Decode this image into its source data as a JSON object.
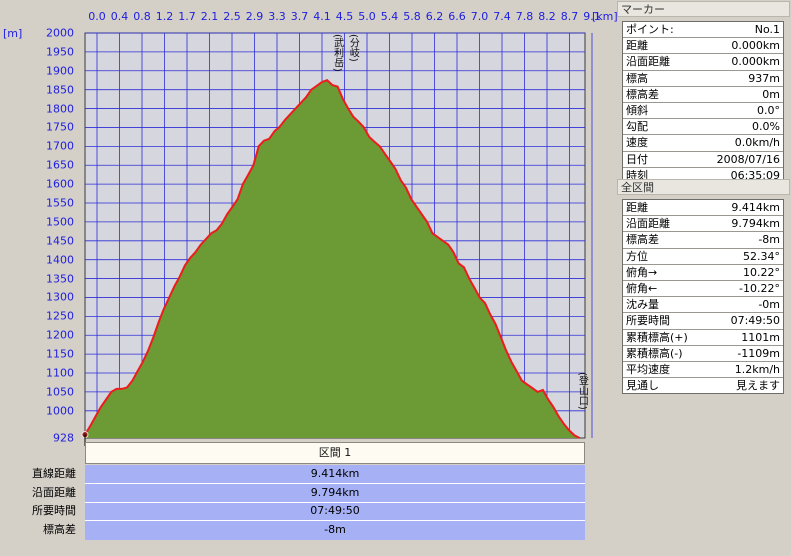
{
  "chart_data": {
    "type": "area",
    "x_unit": "[km]",
    "y_unit": "[m]",
    "x_ticks": [
      "0.0",
      "0.4",
      "0.8",
      "1.2",
      "1.7",
      "2.1",
      "2.5",
      "2.9",
      "3.3",
      "3.7",
      "4.1",
      "4.5",
      "5.0",
      "5.4",
      "5.8",
      "6.2",
      "6.6",
      "7.0",
      "7.4",
      "7.8",
      "8.2",
      "8.7",
      "9.1"
    ],
    "y_ticks": [
      2000,
      1950,
      1900,
      1850,
      1800,
      1750,
      1700,
      1650,
      1600,
      1550,
      1500,
      1450,
      1400,
      1350,
      1300,
      1250,
      1200,
      1150,
      1100,
      1050,
      1000
    ],
    "y_min_label": "928",
    "xlim": [
      0,
      9.5
    ],
    "ylim": [
      928,
      2000
    ],
    "grid": true,
    "fill_color": "#6c9a35",
    "line_color": "#ee1c1c",
    "series": [
      {
        "x": [
          0.0,
          0.1,
          0.2,
          0.3,
          0.4,
          0.5,
          0.6,
          0.7,
          0.8,
          0.9,
          1.0,
          1.1,
          1.2,
          1.3,
          1.4,
          1.5,
          1.6,
          1.7,
          1.8,
          1.9,
          2.0,
          2.1,
          2.2,
          2.3,
          2.4,
          2.5,
          2.6,
          2.7,
          2.8,
          2.9,
          3.0,
          3.1,
          3.2,
          3.3,
          3.4,
          3.5,
          3.6,
          3.7,
          3.8,
          3.9,
          4.0,
          4.1,
          4.2,
          4.3,
          4.4,
          4.5,
          4.6,
          4.7,
          4.8,
          4.9,
          5.0,
          5.1,
          5.2,
          5.3,
          5.4,
          5.5,
          5.6,
          5.7,
          5.8,
          5.9,
          6.0,
          6.1,
          6.2,
          6.3,
          6.4,
          6.5,
          6.6,
          6.7,
          6.8,
          6.9,
          7.0,
          7.1,
          7.2,
          7.3,
          7.4,
          7.5,
          7.6,
          7.7,
          7.8,
          7.9,
          8.0,
          8.1,
          8.2,
          8.3,
          8.4,
          8.5,
          8.6,
          8.7,
          8.8,
          8.9,
          9.0,
          9.1,
          9.2,
          9.3,
          9.4
        ],
        "y": [
          937,
          960,
          985,
          1010,
          1030,
          1050,
          1058,
          1058,
          1062,
          1080,
          1105,
          1130,
          1160,
          1195,
          1235,
          1270,
          1300,
          1330,
          1355,
          1385,
          1405,
          1420,
          1440,
          1455,
          1470,
          1478,
          1495,
          1520,
          1540,
          1560,
          1600,
          1625,
          1650,
          1700,
          1715,
          1720,
          1740,
          1752,
          1770,
          1785,
          1800,
          1815,
          1830,
          1850,
          1860,
          1870,
          1875,
          1862,
          1858,
          1825,
          1800,
          1778,
          1765,
          1750,
          1725,
          1712,
          1700,
          1680,
          1660,
          1640,
          1610,
          1590,
          1560,
          1540,
          1520,
          1500,
          1470,
          1460,
          1450,
          1440,
          1420,
          1390,
          1380,
          1350,
          1325,
          1300,
          1285,
          1255,
          1230,
          1195,
          1160,
          1130,
          1105,
          1080,
          1070,
          1060,
          1050,
          1055,
          1030,
          1010,
          985,
          965,
          948,
          935,
          928
        ]
      }
    ]
  },
  "annotations": [
    {
      "text": "(武利岳)",
      "x": 4.8
    },
    {
      "text": "(分岐)",
      "x": 5.1
    },
    {
      "text": "(登山口)",
      "x": 9.45
    }
  ],
  "section": {
    "title": "区間 1",
    "rows": [
      {
        "label": "直線距離",
        "value": "9.414km"
      },
      {
        "label": "沿面距離",
        "value": "9.794km"
      },
      {
        "label": "所要時間",
        "value": "07:49:50"
      },
      {
        "label": "標高差",
        "value": "-8m"
      }
    ]
  },
  "marker_panel": {
    "title": "マーカー",
    "rows": [
      {
        "label": "ポイント:",
        "value": "No.1"
      },
      {
        "label": "距離",
        "value": "0.000km"
      },
      {
        "label": "沿面距離",
        "value": "0.000km"
      },
      {
        "label": "標高",
        "value": "937m"
      },
      {
        "label": "標高差",
        "value": "0m"
      },
      {
        "label": "傾斜",
        "value": "0.0°"
      },
      {
        "label": "勾配",
        "value": "0.0%"
      },
      {
        "label": "速度",
        "value": "0.0km/h"
      },
      {
        "label": "日付",
        "value": "2008/07/16"
      },
      {
        "label": "時刻",
        "value": "06:35:09"
      }
    ]
  },
  "full_section_panel": {
    "title": "全区間",
    "rows": [
      {
        "label": "距離",
        "value": "9.414km"
      },
      {
        "label": "沿面距離",
        "value": "9.794km"
      },
      {
        "label": "標高差",
        "value": "-8m"
      },
      {
        "label": "方位",
        "value": "52.34°"
      },
      {
        "label": "俯角→",
        "value": "10.22°"
      },
      {
        "label": "俯角←",
        "value": "-10.22°"
      },
      {
        "label": "沈み量",
        "value": "-0m"
      },
      {
        "label": "所要時間",
        "value": "07:49:50"
      },
      {
        "label": "累積標高(+)",
        "value": "1101m"
      },
      {
        "label": "累積標高(-)",
        "value": "-1109m"
      },
      {
        "label": "平均速度",
        "value": "1.2km/h"
      },
      {
        "label": "見通し",
        "value": "見えます"
      }
    ]
  }
}
